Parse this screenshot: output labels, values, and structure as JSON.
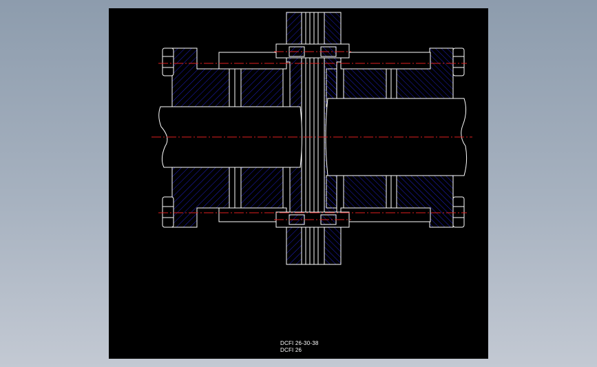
{
  "drawing": {
    "title_lines": [
      "DCFI 26-30-38",
      "DCFI 26"
    ],
    "colors": {
      "background": "#000000",
      "outline": "#ffffff",
      "hatch": "#2020c8",
      "centerline": "#e02020",
      "desktop": "#9aa7b6"
    }
  }
}
